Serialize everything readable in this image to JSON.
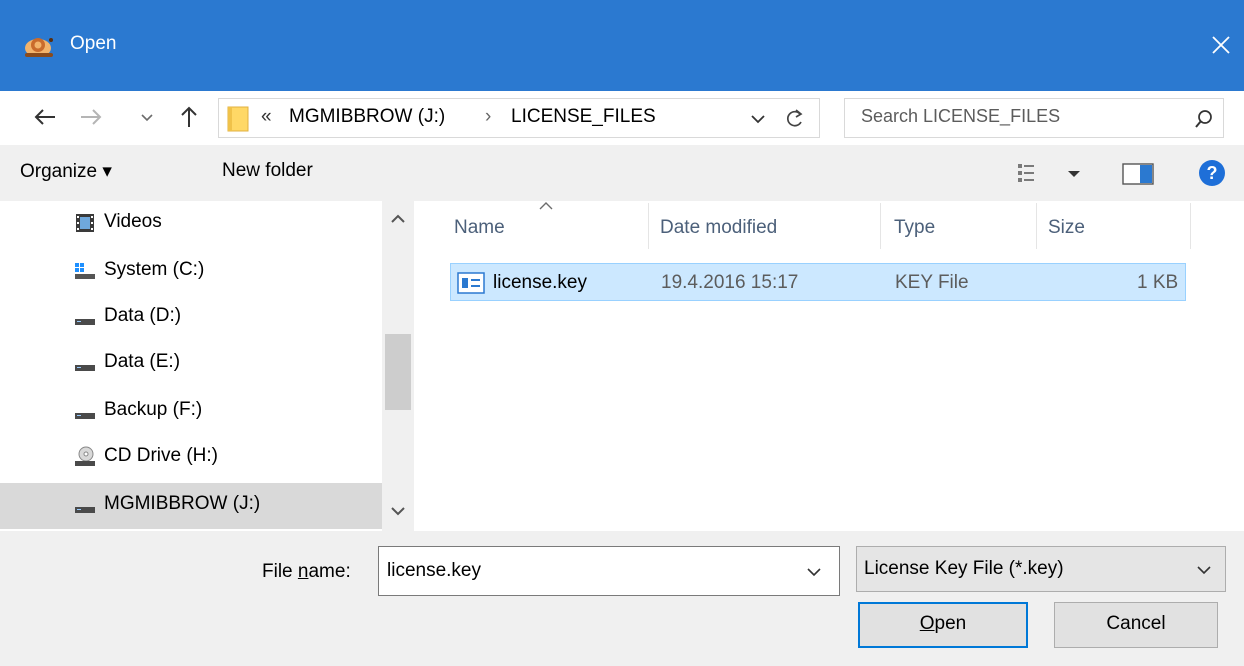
{
  "window": {
    "title": "Open",
    "app_icon": "snail-app-icon",
    "close_icon": "close-icon"
  },
  "navigation": {
    "back_icon": "arrow-left-icon",
    "forward_icon": "arrow-right-icon",
    "recent_icon": "chevron-down-icon",
    "up_icon": "arrow-up-icon",
    "breadcrumb": {
      "overflow": "«",
      "drive": "MGMIBBROW (J:)",
      "separator": "›",
      "folder": "LICENSE_FILES"
    },
    "refresh_icon": "refresh-icon",
    "search_placeholder": "Search LICENSE_FILES",
    "search_icon": "search-icon"
  },
  "toolbar": {
    "organize_label": "Organize ▾",
    "new_folder_label": "New folder",
    "view_icon": "view-options-icon",
    "preview_icon": "preview-pane-icon",
    "help_icon": "help-icon"
  },
  "sidebar": {
    "items": [
      {
        "label": "Videos",
        "icon": "videos-icon"
      },
      {
        "label": "System (C:)",
        "icon": "windows-drive-icon"
      },
      {
        "label": "Data (D:)",
        "icon": "drive-icon"
      },
      {
        "label": "Data (E:)",
        "icon": "drive-icon"
      },
      {
        "label": "Backup (F:)",
        "icon": "drive-icon"
      },
      {
        "label": "CD Drive (H:)",
        "icon": "cd-drive-icon"
      },
      {
        "label": "MGMIBBROW (J:)",
        "icon": "drive-icon",
        "selected": true
      }
    ]
  },
  "file_list": {
    "columns": [
      "Name",
      "Date modified",
      "Type",
      "Size"
    ],
    "sort_icon": "sort-ascending-icon",
    "rows": [
      {
        "name": "license.key",
        "date": "19.4.2016 15:17",
        "type": "KEY File",
        "size": "1 KB",
        "icon": "key-file-icon"
      }
    ]
  },
  "footer": {
    "file_name_label_pre": "File ",
    "file_name_label_u": "n",
    "file_name_label_post": "ame:",
    "file_name_value": "license.key",
    "file_type_value": "License Key File (*.key)",
    "open_label_u": "O",
    "open_label_rest": "pen",
    "cancel_label": "Cancel"
  },
  "colors": {
    "titlebar": "#2b79d0",
    "selection": "#cce8ff",
    "accent": "#0078d7"
  }
}
